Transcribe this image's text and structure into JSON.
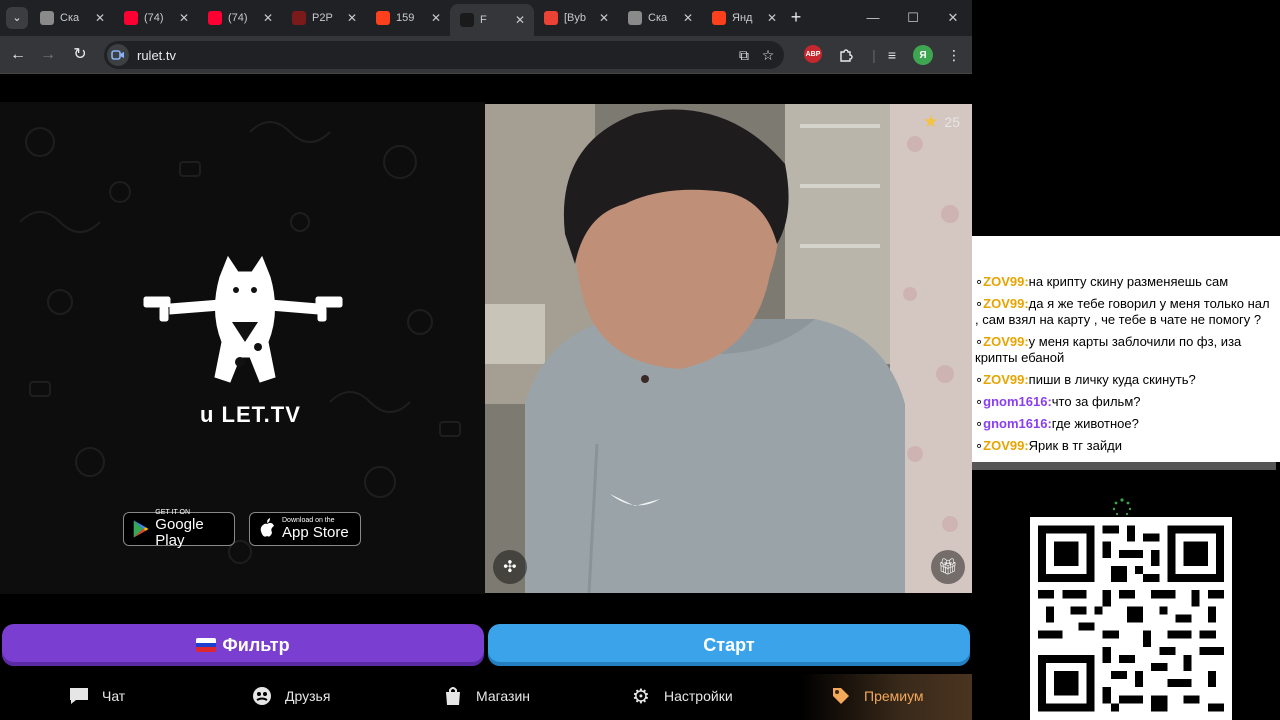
{
  "tabs": [
    {
      "title": "Ска",
      "favicon": "document-icon",
      "color": "#8a8a8a",
      "active": false
    },
    {
      "title": "(74)",
      "favicon": "youtube-icon",
      "color": "#ff0033",
      "active": false
    },
    {
      "title": "(74)",
      "favicon": "youtube-icon",
      "color": "#ff0033",
      "active": false
    },
    {
      "title": "P2P",
      "favicon": "p2p-icon",
      "color": "#7a1a1a",
      "active": false
    },
    {
      "title": "159",
      "favicon": "yandex-icon",
      "color": "#fc3f1d",
      "active": false
    },
    {
      "title": "F",
      "favicon": "rulet-icon",
      "color": "#1a1a1a",
      "active": true
    },
    {
      "title": "[Byb",
      "favicon": "gmail-icon",
      "color": "#ea4335",
      "active": false
    },
    {
      "title": "Ска",
      "favicon": "document-icon",
      "color": "#8a8a8a",
      "active": false
    },
    {
      "title": "Янд",
      "favicon": "yandex-icon",
      "color": "#fc3f1d",
      "active": false
    }
  ],
  "toolbar": {
    "url": "rulet.tv",
    "abp_label": "ABP",
    "profile_initial": "Я"
  },
  "page": {
    "logo_text": "u LET.TV",
    "google_play": {
      "small": "GET IT ON",
      "big": "Google Play"
    },
    "app_store": {
      "small": "Download on the",
      "big": "App Store"
    },
    "star_count": "25",
    "filter_label": "Фильтр",
    "start_label": "Старт",
    "nav": [
      {
        "label": "Чат",
        "icon": "chat-icon"
      },
      {
        "label": "Друзья",
        "icon": "friends-icon"
      },
      {
        "label": "Магазин",
        "icon": "shop-bag-icon"
      },
      {
        "label": "Настройки",
        "icon": "gear-icon"
      },
      {
        "label": "Премиум",
        "icon": "tag-icon"
      }
    ]
  },
  "chat": {
    "messages": [
      {
        "nick": "ZOV99:",
        "text": "на крипту скину разменяешь сам",
        "color": "#e5a400"
      },
      {
        "nick": "ZOV99:",
        "text": "да я же тебе говорил у меня только нал , сам взял на карту , че тебе в чате не помогу ?",
        "color": "#e5a400"
      },
      {
        "nick": "ZOV99:",
        "text": "у меня карты заблочили по фз, иза крипты ебаной",
        "color": "#e5a400"
      },
      {
        "nick": "ZOV99:",
        "text": "пиши в личку куда скинуть?",
        "color": "#e5a400"
      },
      {
        "nick": "gnom1616:",
        "text": "что за фильм?",
        "color": "#8a3ff0"
      },
      {
        "nick": "gnom1616:",
        "text": "где животное?",
        "color": "#8a3ff0"
      },
      {
        "nick": "ZOV99:",
        "text": "Ярик в тг зайди",
        "color": "#e5a400"
      }
    ]
  },
  "colors": {
    "filter_button": "#7a3fd0",
    "start_button": "#3aa3ea",
    "premium": "#f3a85a"
  }
}
